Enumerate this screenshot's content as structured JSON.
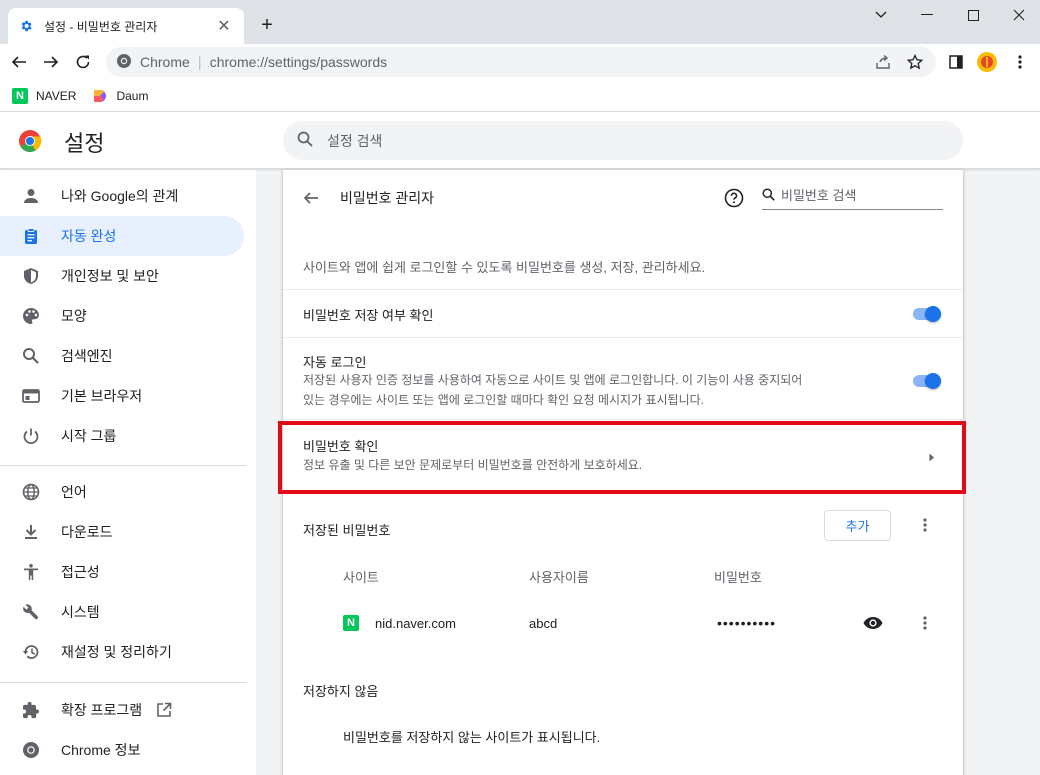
{
  "tab": {
    "title": "설정 - 비밀번호 관리자",
    "close": "✕"
  },
  "newtab": "+",
  "window": {
    "minimize": "minimize",
    "maximize": "maximize",
    "close": "close"
  },
  "omnibox": {
    "site": "Chrome",
    "sep": "|",
    "url": "chrome://settings/passwords"
  },
  "bookmarks": [
    {
      "label": "NAVER",
      "icon": "N",
      "color": "#03c75a"
    },
    {
      "label": "Daum",
      "icon": "D",
      "color": "#ffffff"
    }
  ],
  "header": {
    "title": "설정",
    "search_placeholder": "설정 검색"
  },
  "sidebar": {
    "items": [
      {
        "label": "나와 Google의 관계",
        "icon": "person-icon"
      },
      {
        "label": "자동 완성",
        "icon": "clipboard-icon",
        "active": true
      },
      {
        "label": "개인정보 및 보안",
        "icon": "shield-icon"
      },
      {
        "label": "모양",
        "icon": "palette-icon"
      },
      {
        "label": "검색엔진",
        "icon": "search-icon"
      },
      {
        "label": "기본 브라우저",
        "icon": "browser-icon"
      },
      {
        "label": "시작 그룹",
        "icon": "power-icon"
      },
      {
        "label": "언어",
        "icon": "globe-icon"
      },
      {
        "label": "다운로드",
        "icon": "download-icon"
      },
      {
        "label": "접근성",
        "icon": "accessibility-icon"
      },
      {
        "label": "시스템",
        "icon": "wrench-icon"
      },
      {
        "label": "재설정 및 정리하기",
        "icon": "restore-icon"
      },
      {
        "label": "확장 프로그램",
        "icon": "puzzle-icon"
      },
      {
        "label": "Chrome 정보",
        "icon": "chrome-icon"
      }
    ]
  },
  "main": {
    "title": "비밀번호 관리자",
    "search_placeholder": "비밀번호 검색",
    "description": "사이트와 앱에 쉽게 로그인할 수 있도록 비밀번호를 생성, 저장, 관리하세요.",
    "offer_to_save": {
      "label": "비밀번호 저장 여부 확인",
      "enabled": true
    },
    "auto_signin": {
      "label": "자동 로그인",
      "sub1": "저장된 사용자 인증 정보를 사용하여 자동으로 사이트 및 앱에 로그인합니다. 이 기능이 사용 중지되어",
      "sub2": "있는 경우에는 사이트 또는 앱에 로그인할 때마다 확인 요청 메시지가 표시됩니다.",
      "enabled": true
    },
    "check_passwords": {
      "label": "비밀번호 확인",
      "sub": "정보 유출 및 다른 보안 문제로부터 비밀번호를 안전하게 보호하세요."
    },
    "saved": {
      "title": "저장된 비밀번호",
      "add_label": "추가",
      "columns": {
        "site": "사이트",
        "username": "사용자이름",
        "password": "비밀번호"
      },
      "rows": [
        {
          "site": "nid.naver.com",
          "username": "abcd",
          "password": "••••••••••"
        }
      ]
    },
    "never_saved": {
      "title": "저장하지 않음",
      "empty": "비밀번호를 저장하지 않는 사이트가 표시됩니다."
    }
  },
  "colors": {
    "accent": "#1a73e8",
    "highlight": "#e10b17",
    "naver": "#03c75a"
  }
}
